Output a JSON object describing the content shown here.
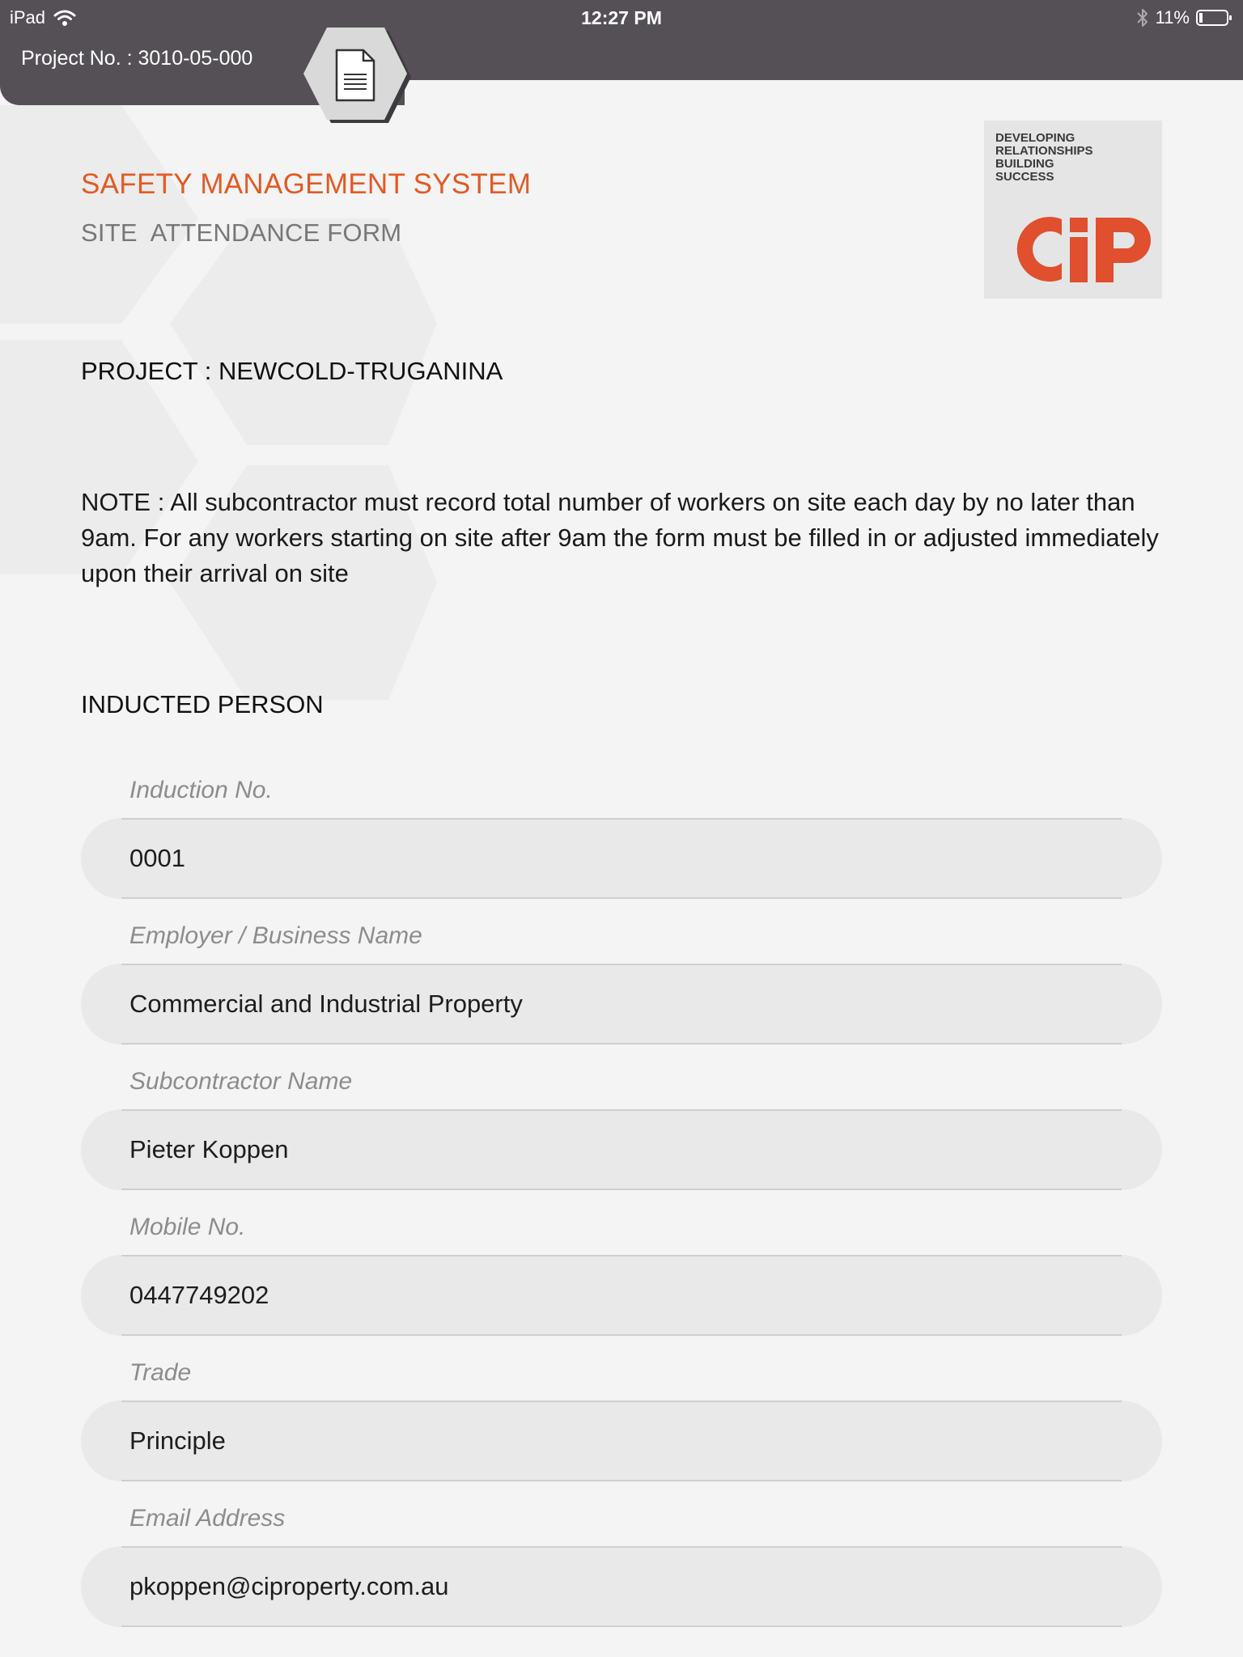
{
  "status_bar": {
    "device": "iPad",
    "time": "12:27 PM",
    "battery": "11%",
    "icons": [
      "wifi-icon",
      "bluetooth-icon",
      "battery-icon"
    ]
  },
  "header": {
    "project_no": "Project No. : 3010-05-000",
    "doc_button_icon": "document-icon"
  },
  "form": {
    "title": "SAFETY MANAGEMENT SYSTEM",
    "subtitle": "SITE  ATTENDANCE FORM",
    "project": "PROJECT : NEWCOLD-TRUGANINA",
    "note": "NOTE : All subcontractor must record total number of workers on site each day by no later than 9am. For any workers starting on site after 9am the form must be filled in or adjusted immediately upon their arrival on site",
    "section": "INDUCTED PERSON"
  },
  "logo": {
    "tagline": [
      "DEVELOPING",
      "RELATIONSHIPS",
      "BUILDING",
      "SUCCESS"
    ],
    "mark": "CIP"
  },
  "fields": [
    {
      "label": "Induction No.",
      "value": "0001"
    },
    {
      "label": "Employer / Business Name",
      "value": "Commercial and Industrial Property"
    },
    {
      "label": "Subcontractor Name",
      "value": "Pieter Koppen"
    },
    {
      "label": "Mobile No.",
      "value": "0447749202"
    },
    {
      "label": "Trade",
      "value": "Principle"
    },
    {
      "label": "Email Address",
      "value": "pkoppen@ciproperty.com.au"
    }
  ],
  "colors": {
    "topbar": "#545056",
    "accent": "#e35a24",
    "background": "#f4f4f4",
    "field_background": "#e9e9e9"
  }
}
